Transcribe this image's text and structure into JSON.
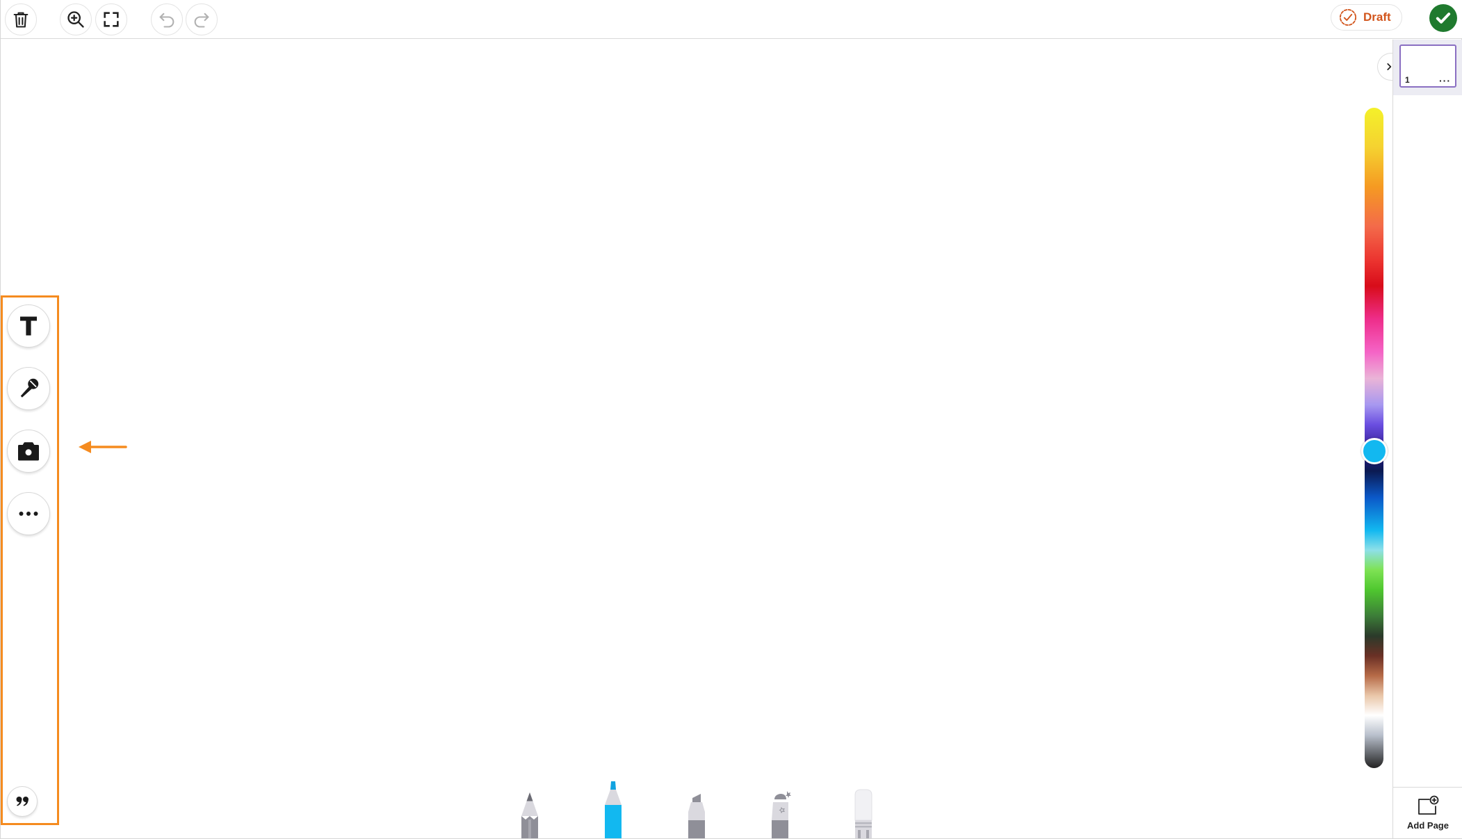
{
  "toolbar": {
    "icons": [
      "trash-icon",
      "zoom-in-icon",
      "fullscreen-icon",
      "undo-icon",
      "redo-icon"
    ],
    "draft_label": "Draft",
    "done_icon": "checkmark-icon"
  },
  "pages": {
    "items": [
      {
        "number": "1",
        "menu": "···"
      }
    ],
    "add_page_label": "Add Page"
  },
  "left_tools": [
    "text-tool",
    "microphone-tool",
    "camera-tool",
    "more-tool",
    "quote-tool"
  ],
  "bottom_tools": [
    "pencil",
    "marker",
    "highlighter",
    "spray",
    "eraser"
  ],
  "colors": {
    "accent": "#f58b1f",
    "selected_color": "#12b8f0",
    "draft": "#d2551c",
    "done": "#1f7a2e",
    "thumbnail_border": "#8a6fc2"
  },
  "color_slider": {
    "selected_position": 0.52
  }
}
